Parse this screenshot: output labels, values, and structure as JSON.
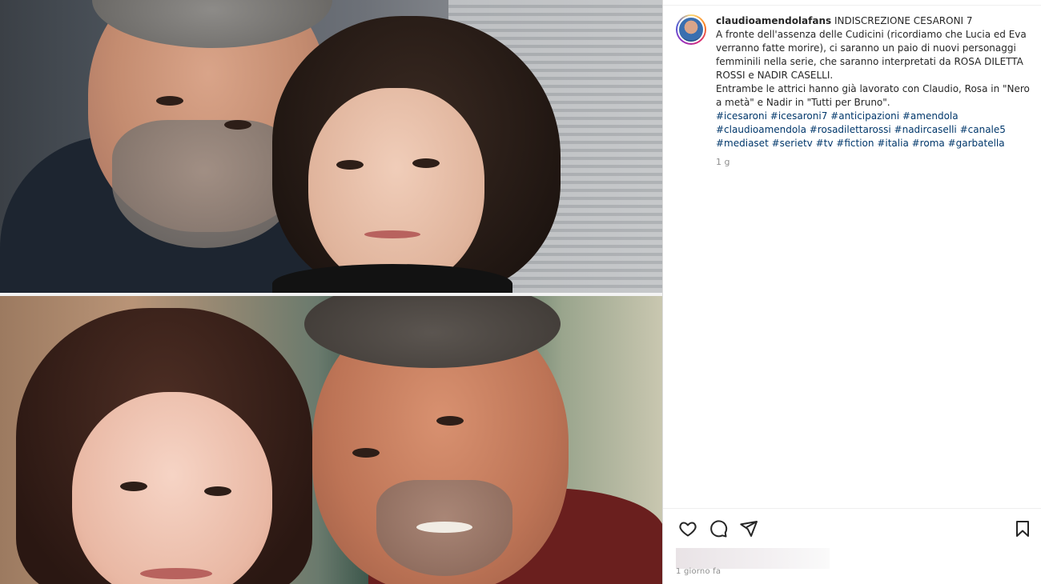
{
  "post": {
    "username": "claudioamendolafans",
    "caption": {
      "title": "INDISCREZIONE CESARONI 7",
      "paragraph1": "A fronte dell'assenza delle Cudicini (ricordiamo che Lucia ed Eva verranno fatte morire), ci saranno un paio di nuovi personaggi femminili nella serie, che saranno interpretati da ROSA DILETTA ROSSI e NADIR CASELLI.",
      "paragraph2": "Entrambe le attrici hanno già lavorato con Claudio, Rosa in \"Nero a metà\" e Nadir in \"Tutti per Bruno\".",
      "hashtags": [
        "#icesaroni",
        "#icesaroni7",
        "#anticipazioni",
        "#amendola",
        "#claudioamendola",
        "#rosadilettarossi",
        "#nadircaselli",
        "#canale5",
        "#mediaset",
        "#serietv",
        "#tv",
        "#fiction",
        "#italia",
        "#roma",
        "#garbatella"
      ]
    },
    "caption_time": "1 g",
    "date_label": "1 giorno fa"
  },
  "actions": {
    "like": "heart-icon",
    "comment": "comment-icon",
    "share": "send-icon",
    "save": "bookmark-icon"
  },
  "colors": {
    "hashtag": "#00376b",
    "text": "#262626",
    "muted": "#8e8e8e",
    "border": "#dbdbdb"
  }
}
